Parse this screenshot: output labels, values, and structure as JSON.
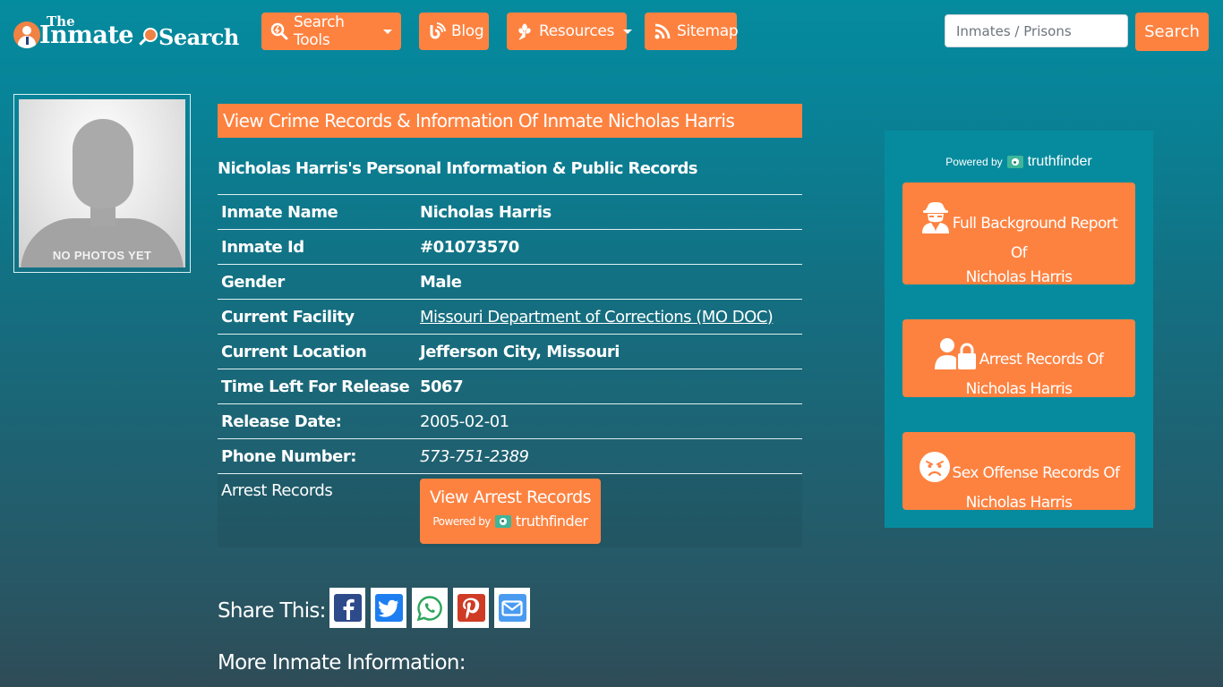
{
  "header": {
    "logo": {
      "the": "The",
      "inmate": "Inmate",
      "search": "Search"
    },
    "nav": [
      {
        "label": "Search Tools",
        "icon": "search-tools-icon",
        "dropdown": true
      },
      {
        "label": "Blog",
        "icon": "blog-icon",
        "dropdown": false
      },
      {
        "label": "Resources",
        "icon": "leaf-icon",
        "dropdown": true
      },
      {
        "label": "Sitemap",
        "icon": "rss-icon",
        "dropdown": false
      }
    ],
    "search": {
      "placeholder": "Inmates / Prisons",
      "value": "",
      "button_label": "Search"
    }
  },
  "photo": {
    "caption": "NO PHOTOS YET"
  },
  "main": {
    "title": "View Crime Records & Information Of Inmate Nicholas Harris",
    "subtitle": "Nicholas Harris's Personal Information & Public Records",
    "rows": [
      {
        "label": "Inmate Name",
        "value": "Nicholas Harris"
      },
      {
        "label": "Inmate Id",
        "value": "#01073570"
      },
      {
        "label": "Gender",
        "value": "Male"
      },
      {
        "label": "Current Facility",
        "value": "Missouri Department of Corrections (MO DOC)"
      },
      {
        "label": "Current Location",
        "value": "Jefferson City, Missouri"
      },
      {
        "label": "Time Left For Release",
        "value": "5067"
      },
      {
        "label": "Release Date:",
        "value": "2005-02-01"
      },
      {
        "label": "Phone Number:",
        "value": "573-751-2389"
      },
      {
        "label": "Arrest Records",
        "value": ""
      }
    ],
    "arrest_button": {
      "label": "View Arrest Records",
      "powered_by": "Powered by",
      "brand": "truthfinder"
    }
  },
  "share": {
    "label": "Share This:",
    "buttons": [
      {
        "name": "facebook",
        "color": "#3b5998"
      },
      {
        "name": "twitter",
        "color": "#1da1f2"
      },
      {
        "name": "whatsapp",
        "color": "#25d366"
      },
      {
        "name": "pinterest",
        "color": "#cb2027"
      },
      {
        "name": "email",
        "color": "#4a9bf0"
      }
    ]
  },
  "more_info": "More Inmate Information:",
  "sidebar": {
    "powered_by": "Powered by",
    "brand": "truthfinder",
    "buttons": [
      {
        "line1": "Full Background Report",
        "line2": "Of",
        "line3": "Nicholas Harris",
        "icon": "spy-icon"
      },
      {
        "line1": "Arrest Records Of",
        "line2": "Nicholas Harris",
        "icon": "user-lock-icon"
      },
      {
        "line1": "Sex Offense Records Of",
        "line2": "Nicholas Harris",
        "icon": "angry-face-icon"
      }
    ]
  },
  "colors": {
    "accent": "#fd8240",
    "background_top": "#058b9e",
    "background_bottom": "#2e4c57",
    "sidebar_panel": "#068b9e"
  }
}
